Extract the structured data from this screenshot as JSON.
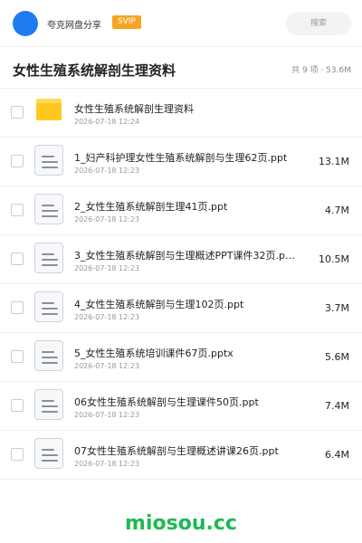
{
  "topbar": {
    "username": "夸克网盘分享",
    "badge": "SVIP",
    "search_placeholder": "搜索"
  },
  "header": {
    "title": "女性生殖系统解剖生理资料",
    "summary": "共 9 项 · 53.6M"
  },
  "items": [
    {
      "type": "folder",
      "name": "女性生殖系统解剖生理资料",
      "date": "2026-07-18 12:24",
      "size": ""
    },
    {
      "type": "doc",
      "name": "1_妇产科护理女性生殖系统解剖与生理62页.ppt",
      "date": "2026-07-18 12:23",
      "size": "13.1M"
    },
    {
      "type": "doc",
      "name": "2_女性生殖系统解剖生理41页.ppt",
      "date": "2026-07-18 12:23",
      "size": "4.7M"
    },
    {
      "type": "doc",
      "name": "3_女性生殖系统解剖与生理概述PPT课件32页.p…",
      "date": "2026-07-18 12:23",
      "size": "10.5M"
    },
    {
      "type": "doc",
      "name": "4_女性生殖系统解剖与生理102页.ppt",
      "date": "2026-07-18 12:23",
      "size": "3.7M"
    },
    {
      "type": "doc",
      "name": "5_女性生殖系统培训课件67页.pptx",
      "date": "2026-07-18 12:23",
      "size": "5.6M"
    },
    {
      "type": "doc",
      "name": "06女性生殖系统解剖与生理课件50页.ppt",
      "date": "2026-07-18 12:23",
      "size": "7.4M"
    },
    {
      "type": "doc",
      "name": "07女性生殖系统解剖与生理概述讲课26页.ppt",
      "date": "2026-07-18 12:23",
      "size": "6.4M"
    }
  ],
  "watermark": "miosou.cc",
  "colors": {
    "accent": "#1e7bf2",
    "badge": "#f5a623",
    "folder": "#ffc81e",
    "watermark": "#1db954"
  },
  "icons": {
    "folder": "folder-icon",
    "document": "document-icon"
  }
}
